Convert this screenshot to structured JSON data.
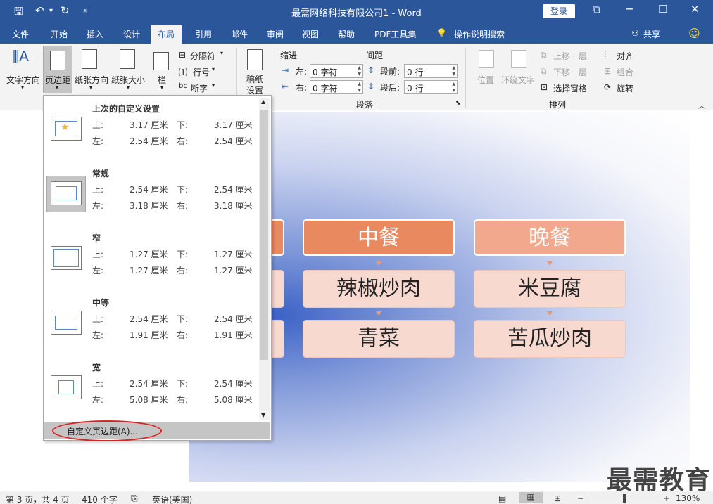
{
  "title_bar": {
    "title": "最需网络科技有限公司1  -  Word",
    "login_label": "登录",
    "minimize": "─",
    "restore": "⧉",
    "maximize": "☐",
    "close": "✕"
  },
  "tabs": [
    "文件",
    "开始",
    "插入",
    "设计",
    "布局",
    "引用",
    "邮件",
    "审阅",
    "视图",
    "帮助",
    "PDF工具集",
    "操作说明搜索"
  ],
  "active_tab": "布局",
  "share_label": "共享",
  "ribbon": {
    "page_setup": {
      "text_direction": "文字方向",
      "margins": "页边距",
      "orientation": "纸张方向",
      "size": "纸张大小",
      "columns": "栏",
      "breaks": "分隔符",
      "line_numbers": "行号",
      "hyphenation": "断字"
    },
    "draft": {
      "line1": "稿纸",
      "line2": "设置"
    },
    "paragraph": {
      "indent_header": "缩进",
      "spacing_header": "间距",
      "left_label": "左:",
      "left_value": "0 字符",
      "right_label": "右:",
      "right_value": "0 字符",
      "before_label": "段前:",
      "before_value": "0 行",
      "after_label": "段后:",
      "after_value": "0 行",
      "group_label": "段落"
    },
    "arrange": {
      "position": "位置",
      "wrap_text": "环绕文字",
      "bring_forward": "上移一层",
      "send_backward": "下移一层",
      "selection_pane": "选择窗格",
      "align": "对齐",
      "group": "组合",
      "rotate": "旋转",
      "group_label": "排列"
    }
  },
  "margins_dropdown": {
    "presets": [
      {
        "name": "上次的自定义设置",
        "top": "3.17 厘米",
        "bottom": "3.17 厘米",
        "left": "2.54 厘米",
        "right": "2.54 厘米"
      },
      {
        "name": "常规",
        "top": "2.54 厘米",
        "bottom": "2.54 厘米",
        "left": "3.18 厘米",
        "right": "3.18 厘米"
      },
      {
        "name": "窄",
        "top": "1.27 厘米",
        "bottom": "1.27 厘米",
        "left": "1.27 厘米",
        "right": "1.27 厘米"
      },
      {
        "name": "中等",
        "top": "2.54 厘米",
        "bottom": "2.54 厘米",
        "left": "1.91 厘米",
        "right": "1.91 厘米"
      },
      {
        "name": "宽",
        "top": "2.54 厘米",
        "bottom": "2.54 厘米",
        "left": "5.08 厘米",
        "right": "5.08 厘米"
      }
    ],
    "labels": {
      "top": "上:",
      "bottom": "下:",
      "left": "左:",
      "right": "右:"
    },
    "custom_margins": "自定义页边距(A)..."
  },
  "diagram": {
    "headers": [
      "中餐",
      "晚餐"
    ],
    "items_col1": [
      "辣椒炒肉",
      "青菜"
    ],
    "items_col2": [
      "米豆腐",
      "苦瓜炒肉"
    ],
    "colors": {
      "header1": "#e8895f",
      "header2": "#f2a88c",
      "item_bg": "#f8d9d0"
    }
  },
  "status_bar": {
    "page": "第 3 页，共 4 页",
    "words": "410 个字",
    "language": "英语(美国)",
    "zoom": "130%"
  },
  "watermark": "最需教育"
}
